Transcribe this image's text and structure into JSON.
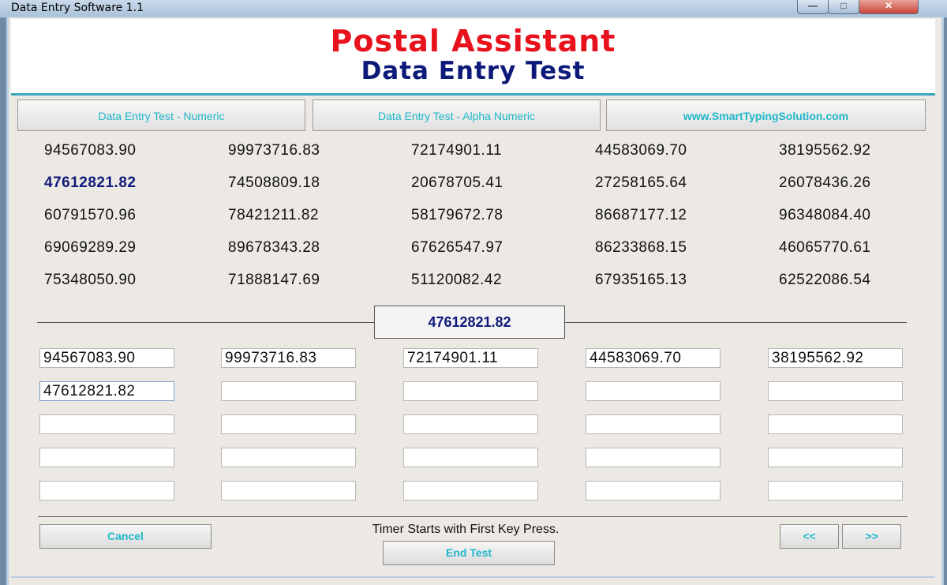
{
  "window": {
    "title": "Data Entry Software 1.1",
    "controls": {
      "minimize": "—",
      "maximize": "□",
      "close": "✕"
    }
  },
  "header": {
    "title": "Postal Assistant",
    "subtitle": "Data Entry Test",
    "title_color": "#e8121c",
    "subtitle_color": "#0e1a7a"
  },
  "tabs": [
    {
      "label": "Data Entry Test - Numeric"
    },
    {
      "label": "Data Entry Test - Alpha Numeric"
    },
    {
      "label": "www.SmartTypingSolution.com"
    }
  ],
  "source_grid": [
    [
      "94567083.90",
      "99973716.83",
      "72174901.11",
      "44583069.70",
      "38195562.92"
    ],
    [
      "47612821.82",
      "74508809.18",
      "20678705.41",
      "27258165.64",
      "26078436.26"
    ],
    [
      "60791570.96",
      "78421211.82",
      "58179672.78",
      "86687177.12",
      "96348084.40"
    ],
    [
      "69069289.29",
      "89678343.28",
      "67626547.97",
      "86233868.15",
      "46065770.61"
    ],
    [
      "75348050.90",
      "71888147.69",
      "51120082.42",
      "67935165.13",
      "62522086.54"
    ]
  ],
  "current_value": "47612821.82",
  "entry_grid": [
    [
      "94567083.90",
      "99973716.83",
      "72174901.11",
      "44583069.70",
      "38195562.92"
    ],
    [
      "47612821.82",
      "",
      "",
      "",
      ""
    ],
    [
      "",
      "",
      "",
      "",
      ""
    ],
    [
      "",
      "",
      "",
      "",
      ""
    ],
    [
      "",
      "",
      "",
      "",
      ""
    ]
  ],
  "footer": {
    "cancel_label": "Cancel",
    "timer_text": "Timer Starts with First Key Press.",
    "end_test_label": "End Test",
    "prev_label": "<<",
    "next_label": ">>"
  },
  "colors": {
    "accent": "#1fb7c9",
    "highlight": "#0e1a7a"
  }
}
